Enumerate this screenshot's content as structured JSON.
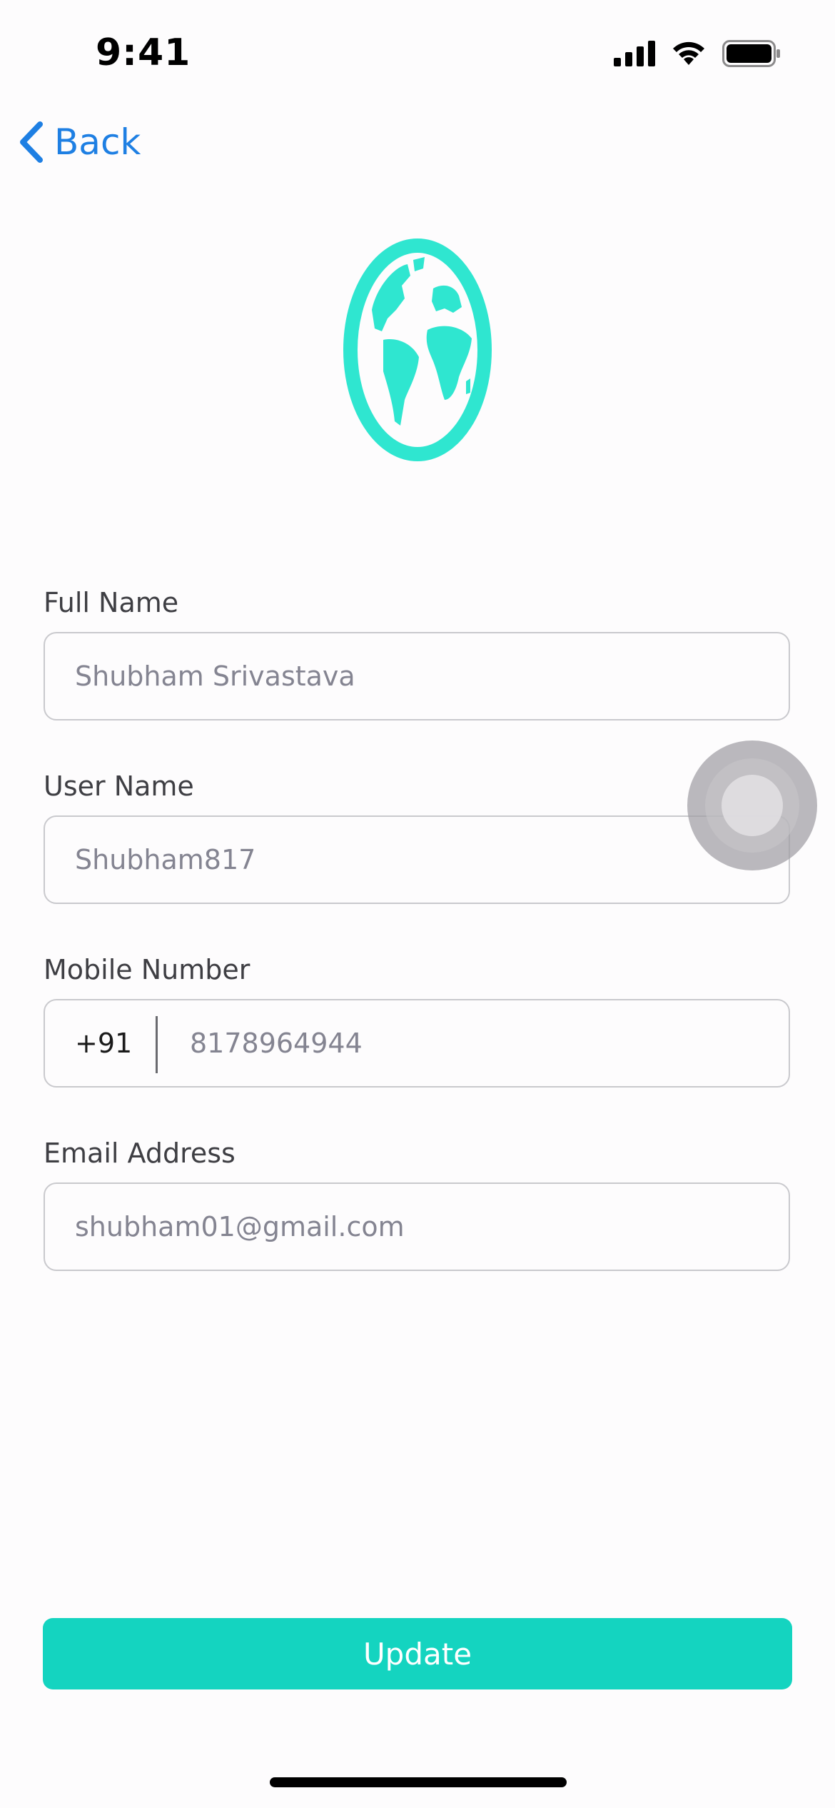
{
  "status_bar": {
    "time": "9:41",
    "icons": [
      "cellular-signal-icon",
      "wifi-icon",
      "battery-icon"
    ]
  },
  "nav": {
    "back_label": "Back",
    "back_icon": "chevron-left-icon"
  },
  "logo": {
    "icon": "globe-icon",
    "color": "#2fe6d0"
  },
  "form": {
    "full_name": {
      "label": "Full Name",
      "placeholder": "Shubham Srivastava"
    },
    "user_name": {
      "label": "User Name",
      "placeholder": "Shubham817"
    },
    "mobile_number": {
      "label": "Mobile Number",
      "country_code": "+91",
      "placeholder": "8178964944"
    },
    "email_address": {
      "label": "Email Address",
      "placeholder": "shubham01@gmail.com"
    }
  },
  "update_button": {
    "label": "Update",
    "color": "#14d4c0"
  },
  "colors": {
    "accent_blue": "#1e7fe3",
    "field_border": "#c9c9cd",
    "placeholder": "#848491"
  }
}
